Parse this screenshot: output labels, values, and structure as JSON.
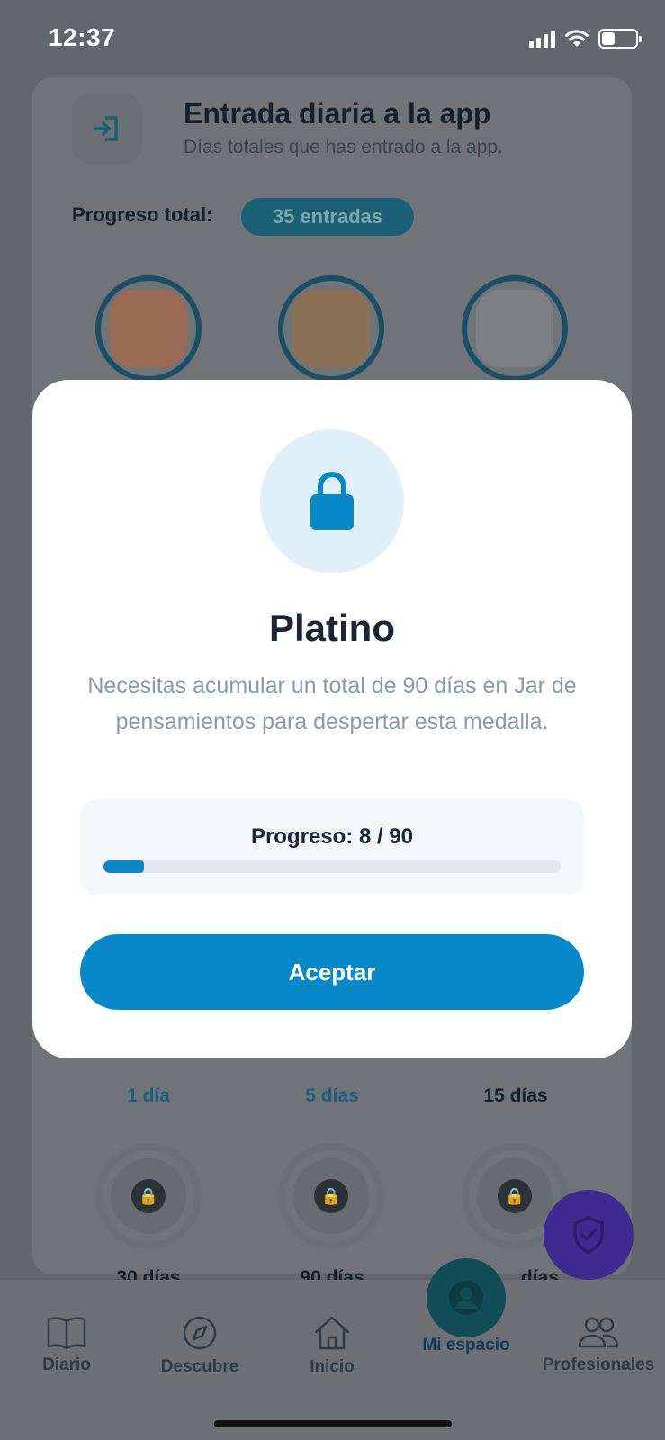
{
  "status_bar": {
    "time": "12:37"
  },
  "background": {
    "header": {
      "icon": "login-icon",
      "title": "Entrada diaria a la app",
      "subtitle": "Días totales que has entrado a la app."
    },
    "progress_label": "Progreso total:",
    "progress_pill": "35 entradas",
    "medals": [
      {
        "label": "1 día",
        "state": "earned",
        "color": "#9a6a55"
      },
      {
        "label": "5 días",
        "state": "earned",
        "color": "#8c7055"
      },
      {
        "label": "15 días",
        "state": "earned",
        "color": "#7e8083"
      },
      {
        "label": "30 días",
        "state": "locked"
      },
      {
        "label": "90 días",
        "state": "locked"
      },
      {
        "label": "días",
        "state": "locked"
      }
    ]
  },
  "modal": {
    "icon": "lock-icon",
    "title": "Platino",
    "description": "Necesitas acumular un total de 90 días en Jar de pensamientos para despertar esta medalla.",
    "progress_text": "Progreso: 8 / 90",
    "progress_current": 8,
    "progress_total": 90,
    "accept_label": "Aceptar"
  },
  "nav": {
    "items": [
      {
        "label": "Diario",
        "icon": "book-icon"
      },
      {
        "label": "Descubre",
        "icon": "compass-icon"
      },
      {
        "label": "Inicio",
        "icon": "home-icon"
      },
      {
        "label": "Mi espacio",
        "icon": "user-icon",
        "active": true
      },
      {
        "label": "Profesionales",
        "icon": "people-icon"
      }
    ]
  },
  "colors": {
    "accent": "#0788c8",
    "modal_title": "#1c2536",
    "description": "#8a9aab",
    "fab": "#3d2b8f"
  }
}
